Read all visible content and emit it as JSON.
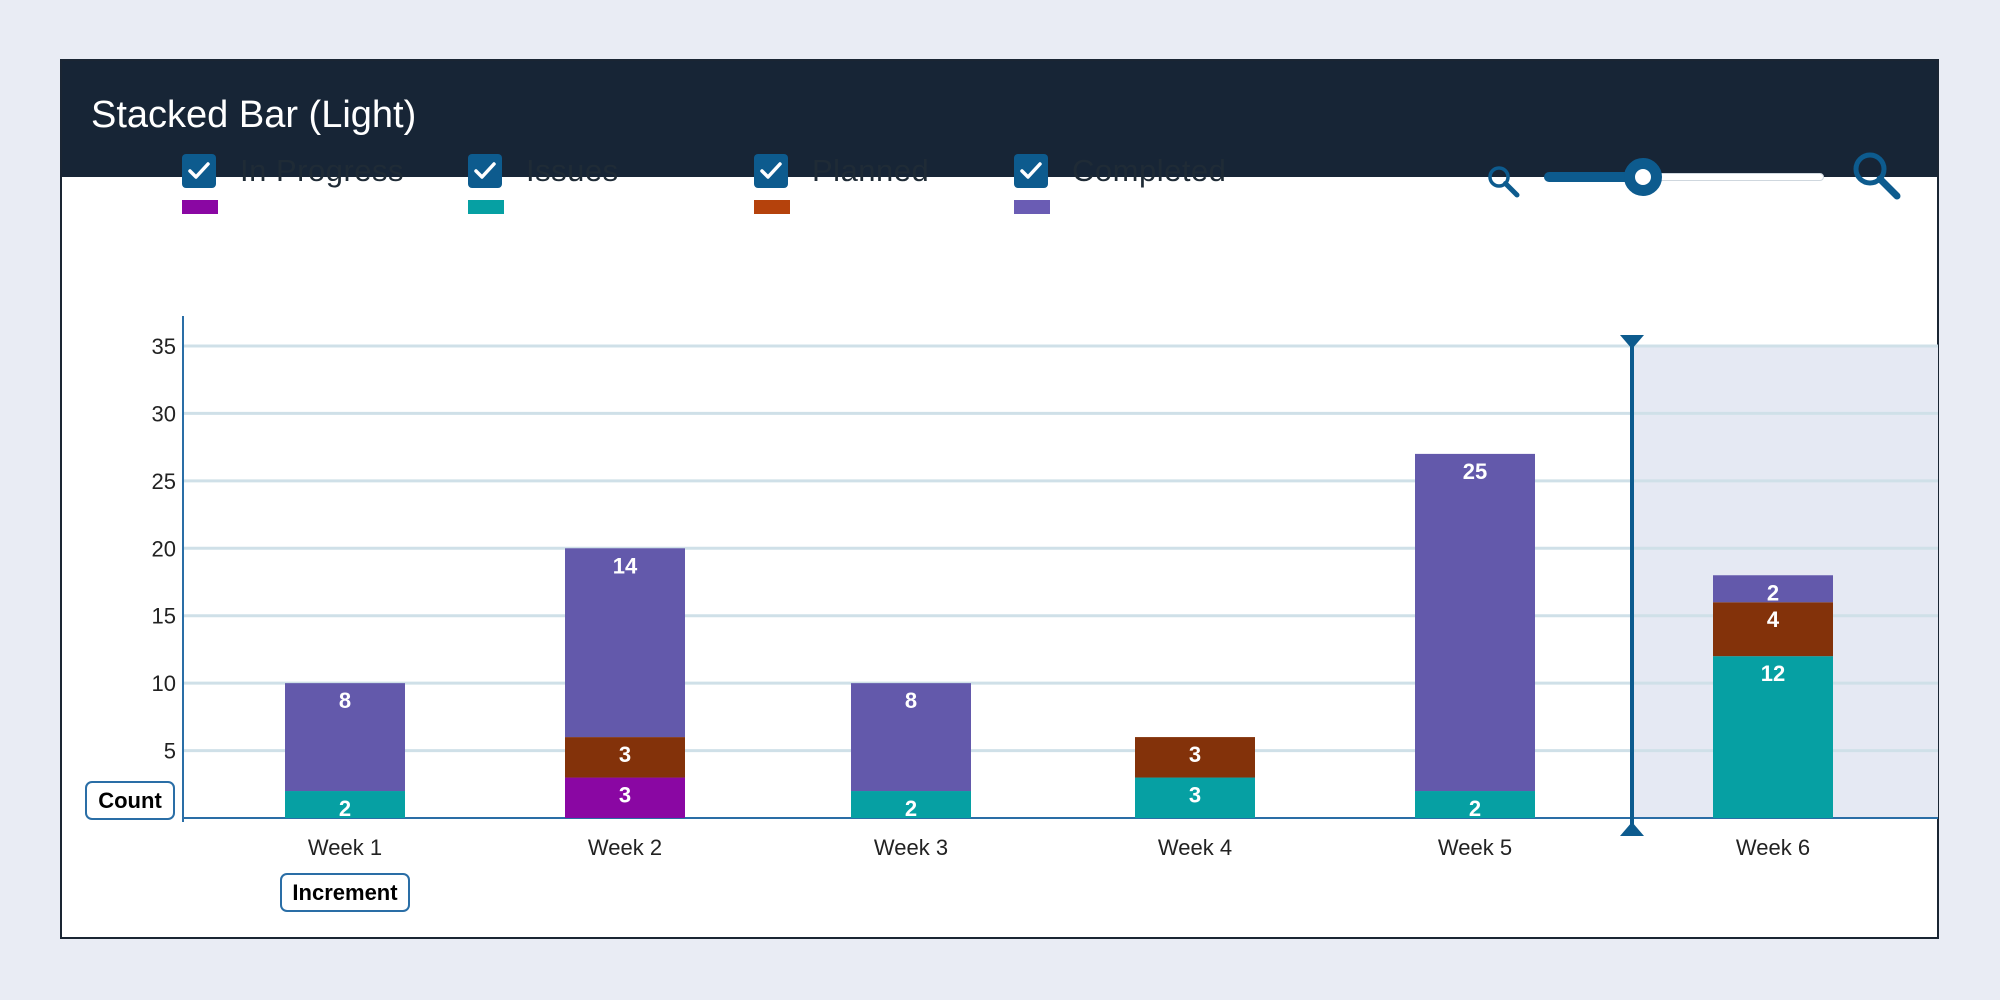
{
  "header": {
    "title": "Stacked Bar (Light)"
  },
  "legend": [
    {
      "label": "In Progress",
      "color": "#8a07a3",
      "checked": true
    },
    {
      "label": "Issues",
      "color": "#06a0a3",
      "checked": true
    },
    {
      "label": "Planned",
      "color": "#b5420c",
      "checked": true
    },
    {
      "label": "Completed",
      "color": "#6a5cb4",
      "checked": true
    }
  ],
  "zoom": {
    "level": 0.35,
    "icon_small": "zoom-out-icon",
    "icon_large": "zoom-in-icon"
  },
  "annotations": {
    "y_button": "Count",
    "x_button": "Increment"
  },
  "chart_data": {
    "type": "bar",
    "stacked": true,
    "categories": [
      "Week 1",
      "Week 2",
      "Week 3",
      "Week 4",
      "Week 5",
      "Week 6"
    ],
    "series": [
      {
        "name": "In Progress",
        "color": "#8a07a3",
        "values": [
          0,
          3,
          0,
          0,
          0,
          0
        ]
      },
      {
        "name": "Issues",
        "color": "#06a0a3",
        "values": [
          2,
          0,
          2,
          3,
          2,
          12
        ]
      },
      {
        "name": "Planned",
        "color": "#83320a",
        "values": [
          0,
          3,
          0,
          3,
          0,
          4
        ]
      },
      {
        "name": "Completed",
        "color": "#6359ab",
        "values": [
          8,
          14,
          8,
          0,
          25,
          2
        ]
      }
    ],
    "ylim": [
      0,
      35
    ],
    "yticks": [
      5,
      10,
      15,
      20,
      25,
      30,
      35
    ],
    "grid": true,
    "highlight_from_category": 5
  }
}
